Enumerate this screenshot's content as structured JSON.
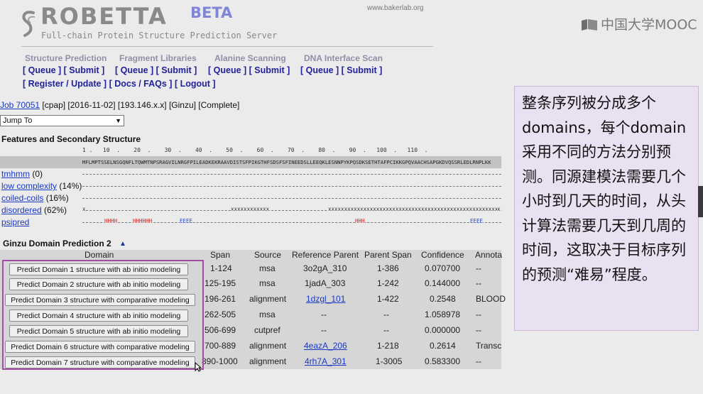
{
  "header": {
    "logo_title": "ROBETTA",
    "logo_badge": "BETA",
    "subtitle": "Full-chain Protein Structure Prediction Server",
    "site_url": "www.bakerlab.org"
  },
  "nav": {
    "sections": [
      {
        "title": "Structure Prediction",
        "queue": "[ Queue ]",
        "submit": "[ Submit ]"
      },
      {
        "title": "Fragment Libraries",
        "queue": "[ Queue ]",
        "submit": "[ Submit ]"
      },
      {
        "title": "Alanine Scanning",
        "queue": "[ Queue ]",
        "submit": "[ Submit ]"
      },
      {
        "title": "DNA Interface Scan",
        "queue": "[ Queue ]",
        "submit": "[ Submit ]"
      }
    ],
    "account_links": [
      "[ Register / Update ]",
      "[ Docs / FAQs ]",
      "[ Logout ]"
    ]
  },
  "job": {
    "link": "Job 70051",
    "details": " [cpap] [2016-11-02] [193.146.x.x] [Ginzu] [Complete]",
    "jump_select": "Jump To"
  },
  "features": {
    "title": "Features and Secondary Structure",
    "ruler": "1 .   10  .    20  .    30  .    40  .    50  .    60  .    70  .    80  .    90  .   100  .   110  .",
    "sequence": "MFLMPTSSELNSGQNFLTQWMTNPSRAGVILNRGFPILEADKEKRAAVDISTSFPIKGTHFSDSFSFINEEDSLLEEQKLESNNPYKPQSDKSETHTAFPCIKKGPQVAACHSAPGKDVQSSRLEDLRNPLKK",
    "tracks": [
      {
        "name": "tmhmm",
        "value": " (0)"
      },
      {
        "name": "low complexity",
        "value": " (14%)"
      },
      {
        "name": "coiled-coils",
        "value": " (16%)"
      },
      {
        "name": "disordered",
        "value": " (62%)"
      },
      {
        "name": "psipred",
        "value": ""
      }
    ],
    "disordered_marks": [
      "x",
      "xxxxxxxxxxxx",
      "xxxxxxxxxxxxxxxxxxxxxxxxxxxxxxxxxxxxxxxxxxxxxxxxxxxxxx",
      "x"
    ],
    "psipred_marks": [
      "HHHH",
      "HHHHHH",
      "EEEE",
      "HHH",
      "EEEE"
    ]
  },
  "ginzu": {
    "title": "Ginzu Domain Prediction 2",
    "columns": [
      "Domain",
      "Span",
      "Source",
      "Reference Parent",
      "Parent Span",
      "Confidence",
      "Annota"
    ],
    "rows": [
      {
        "button": "Predict Domain 1 structure with ab initio modeling",
        "span": "1-124",
        "source": "msa",
        "ref_parent": "3o2gA_310",
        "parent_span": "1-386",
        "confidence": "0.070700",
        "annotation": "--"
      },
      {
        "button": "Predict Domain 2 structure with ab initio modeling",
        "span": "125-195",
        "source": "msa",
        "ref_parent": "1jadA_303",
        "parent_span": "1-242",
        "confidence": "0.144000",
        "annotation": "--"
      },
      {
        "button": "Predict Domain 3 structure with comparative modeling",
        "span": "196-261",
        "source": "alignment",
        "ref_parent": "1dzgl_101",
        "parent_span": "1-422",
        "confidence": "0.2548",
        "annotation": "BLOOD"
      },
      {
        "button": "Predict Domain 4 structure with ab initio modeling",
        "span": "262-505",
        "source": "msa",
        "ref_parent": "--",
        "parent_span": "--",
        "confidence": "1.058978",
        "annotation": "--"
      },
      {
        "button": "Predict Domain 5 structure with ab initio modeling",
        "span": "506-699",
        "source": "cutpref",
        "ref_parent": "--",
        "parent_span": "--",
        "confidence": "0.000000",
        "annotation": "--"
      },
      {
        "button": "Predict Domain 6 structure with comparative modeling",
        "span": "700-889",
        "source": "alignment",
        "ref_parent": "4eazA_206",
        "parent_span": "1-218",
        "confidence": "0.2614",
        "annotation": "Transc"
      },
      {
        "button": "Predict Domain 7 structure with comparative modeling",
        "span": "890-1000",
        "source": "alignment",
        "ref_parent": "4rh7A_301",
        "parent_span": "1-3005",
        "confidence": "0.583300",
        "annotation": "--"
      }
    ]
  },
  "annotation": {
    "text": "整条序列被分成多个domains，每个domain采用不同的方法分别预测。同源建模法需要几个小时到几天的时间，从头计算法需要几天到几周的时间，这取决于目标序列的预测“难易”程度。"
  },
  "watermark": {
    "text": "中国大学MOOC"
  },
  "colors": {
    "link": "#1a39c2",
    "nav": "#22229a",
    "beta": "#7f86da",
    "highlight_border": "#a24ea4",
    "annotation_bg": "#e9e0f1",
    "helix": "#cc2222",
    "strand": "#2244cc"
  }
}
